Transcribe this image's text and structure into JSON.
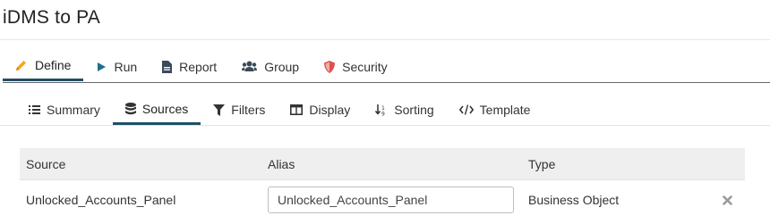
{
  "page": {
    "title": "iDMS to PA"
  },
  "main_tabs": [
    {
      "label": "Define",
      "icon": "pencil-icon",
      "active": true
    },
    {
      "label": "Run",
      "icon": "play-icon"
    },
    {
      "label": "Report",
      "icon": "file-icon"
    },
    {
      "label": "Group",
      "icon": "users-icon"
    },
    {
      "label": "Security",
      "icon": "shield-icon"
    }
  ],
  "sub_tabs": [
    {
      "label": "Summary",
      "icon": "list-icon"
    },
    {
      "label": "Sources",
      "icon": "database-icon",
      "active": true
    },
    {
      "label": "Filters",
      "icon": "filter-icon"
    },
    {
      "label": "Display",
      "icon": "window-icon"
    },
    {
      "label": "Sorting",
      "icon": "sort-icon"
    },
    {
      "label": "Template",
      "icon": "code-icon"
    }
  ],
  "table": {
    "headers": {
      "source": "Source",
      "alias": "Alias",
      "type": "Type"
    },
    "rows": [
      {
        "source": "Unlocked_Accounts_Panel",
        "alias": "Unlocked_Accounts_Panel",
        "type": "Business Object"
      }
    ]
  },
  "colors": {
    "active_tab": "#1e4f66",
    "pencil": "#f0a81c",
    "play": "#1f6f8b",
    "shield": "#d9534f",
    "icon_dark": "#3a4a5a"
  }
}
